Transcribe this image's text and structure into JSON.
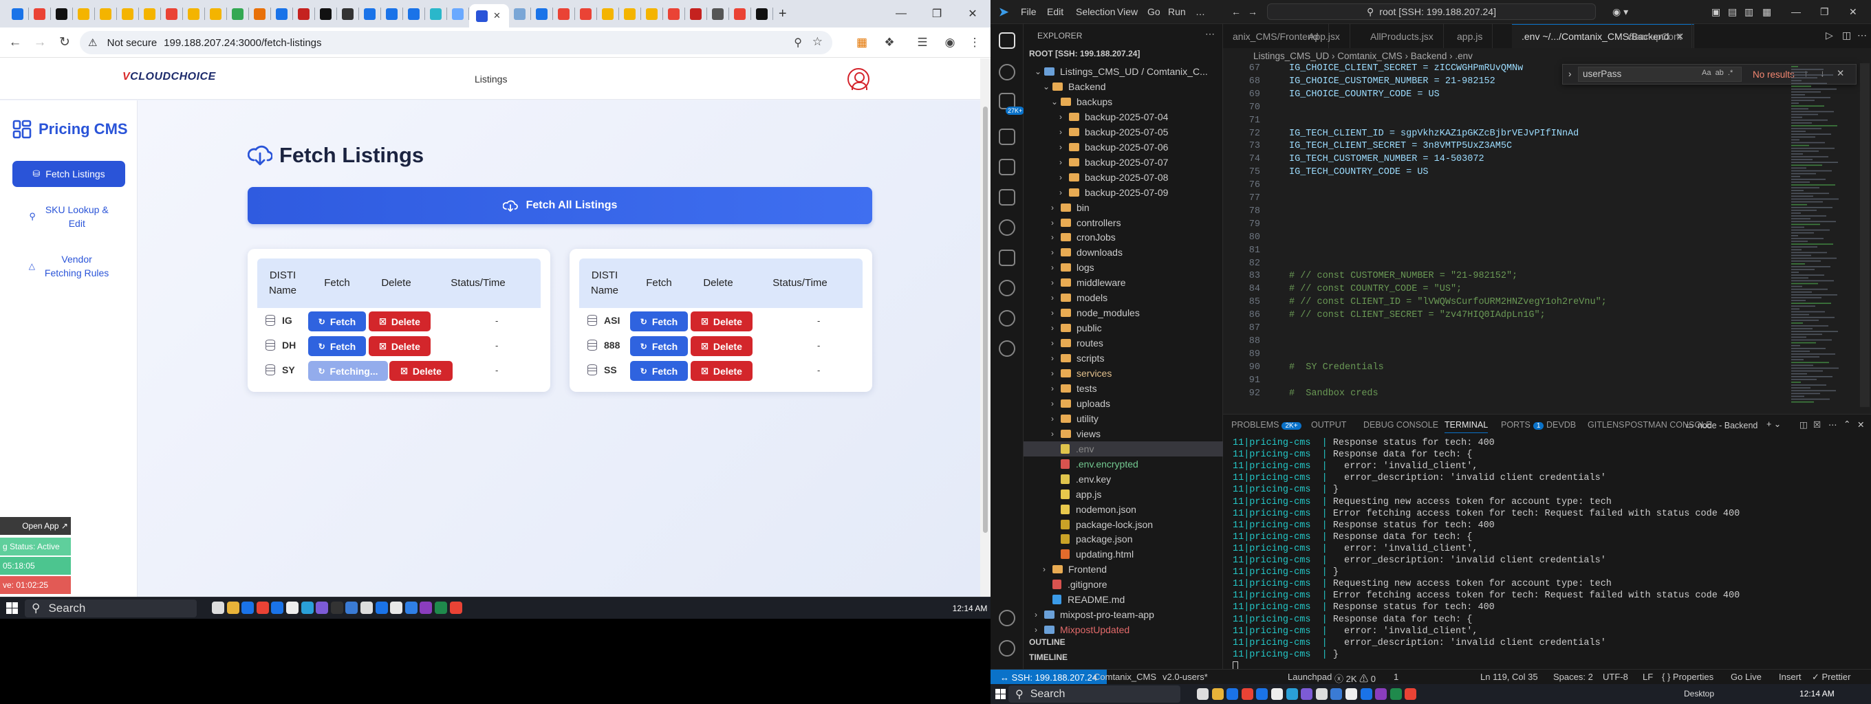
{
  "browser": {
    "tab_title": "",
    "not_secure": "Not secure",
    "url": "199.188.207.24:3000/fetch-listings"
  },
  "app": {
    "logo_main": "CLOUDCHOICE",
    "logo_v": "V",
    "nav_listings": "Listings",
    "brand": "Pricing CMS",
    "sidebar": [
      {
        "label": "Fetch Listings",
        "icon": "download-icon"
      },
      {
        "label": "SKU Lookup &\nEdit",
        "icon": "search-icon"
      },
      {
        "label": "Vendor\nFetching Rules",
        "icon": "warning-icon"
      }
    ],
    "page_title": "Fetch Listings",
    "fetch_all": "Fetch All Listings",
    "headers": {
      "disti": "DISTI\nName",
      "fetch": "Fetch",
      "delete": "Delete",
      "status": "Status/Time"
    },
    "left_table": [
      {
        "name": "IG",
        "fetch": "Fetch",
        "delete": "Delete",
        "status": "-",
        "state": "idle"
      },
      {
        "name": "DH",
        "fetch": "Fetch",
        "delete": "Delete",
        "status": "-",
        "state": "idle"
      },
      {
        "name": "SY",
        "fetch": "Fetching...",
        "delete": "Delete",
        "status": "-",
        "state": "loading"
      }
    ],
    "right_table": [
      {
        "name": "ASI",
        "fetch": "Fetch",
        "delete": "Delete",
        "status": "-",
        "state": "idle"
      },
      {
        "name": "888",
        "fetch": "Fetch",
        "delete": "Delete",
        "status": "-",
        "state": "idle"
      },
      {
        "name": "SS",
        "fetch": "Fetch",
        "delete": "Delete",
        "status": "-",
        "state": "idle"
      }
    ]
  },
  "dock": {
    "open_app": "Open App ↗",
    "status": "g Status: Active",
    "time1": "05:18:05",
    "time2": "ve: 01:02:25"
  },
  "taskbar1": {
    "search": "Search",
    "clock": "12:14 AM"
  },
  "vscode": {
    "menu": [
      "File",
      "Edit",
      "Selection",
      "View",
      "Go",
      "Run",
      "…"
    ],
    "command_center": "root [SSH: 199.188.207.24]",
    "explorer_title": "EXPLORER",
    "root": "ROOT [SSH: 199.188.207.24]",
    "tree": [
      {
        "t": "Listings_CMS_UD / Comtanix_C...",
        "d": 1,
        "k": "open"
      },
      {
        "t": "Backend",
        "d": 2,
        "k": "open"
      },
      {
        "t": "backups",
        "d": 3,
        "k": "open"
      },
      {
        "t": "backup-2025-07-04",
        "d": 4,
        "k": "closed"
      },
      {
        "t": "backup-2025-07-05",
        "d": 4,
        "k": "closed"
      },
      {
        "t": "backup-2025-07-06",
        "d": 4,
        "k": "closed"
      },
      {
        "t": "backup-2025-07-07",
        "d": 4,
        "k": "closed"
      },
      {
        "t": "backup-2025-07-08",
        "d": 4,
        "k": "closed"
      },
      {
        "t": "backup-2025-07-09",
        "d": 4,
        "k": "closed"
      },
      {
        "t": "bin",
        "d": 3,
        "k": "closed"
      },
      {
        "t": "controllers",
        "d": 3,
        "k": "closed"
      },
      {
        "t": "cronJobs",
        "d": 3,
        "k": "closed"
      },
      {
        "t": "downloads",
        "d": 3,
        "k": "closed"
      },
      {
        "t": "logs",
        "d": 3,
        "k": "closed"
      },
      {
        "t": "middleware",
        "d": 3,
        "k": "closed"
      },
      {
        "t": "models",
        "d": 3,
        "k": "closed"
      },
      {
        "t": "node_modules",
        "d": 3,
        "k": "closed"
      },
      {
        "t": "public",
        "d": 3,
        "k": "closed"
      },
      {
        "t": "routes",
        "d": 3,
        "k": "closed"
      },
      {
        "t": "scripts",
        "d": 3,
        "k": "closed"
      },
      {
        "t": "services",
        "d": 3,
        "k": "closed"
      },
      {
        "t": "tests",
        "d": 3,
        "k": "closed"
      },
      {
        "t": "uploads",
        "d": 3,
        "k": "closed"
      },
      {
        "t": "utility",
        "d": 3,
        "k": "closed"
      },
      {
        "t": "views",
        "d": 3,
        "k": "closed"
      },
      {
        "t": ".env",
        "d": 3,
        "k": "file"
      },
      {
        "t": ".env.encrypted",
        "d": 3,
        "k": "file"
      },
      {
        "t": ".env.key",
        "d": 3,
        "k": "file"
      },
      {
        "t": "app.js",
        "d": 3,
        "k": "file"
      },
      {
        "t": "nodemon.json",
        "d": 3,
        "k": "file"
      },
      {
        "t": "package-lock.json",
        "d": 3,
        "k": "file"
      },
      {
        "t": "package.json",
        "d": 3,
        "k": "file"
      },
      {
        "t": "updating.html",
        "d": 3,
        "k": "file"
      },
      {
        "t": "Frontend",
        "d": 2,
        "k": "closed"
      },
      {
        "t": ".gitignore",
        "d": 2,
        "k": "file"
      },
      {
        "t": "README.md",
        "d": 2,
        "k": "file"
      },
      {
        "t": "mixpost-pro-team-app",
        "d": 1,
        "k": "closed"
      },
      {
        "t": "MixpostUpdated",
        "d": 1,
        "k": "closed"
      }
    ],
    "outline": "OUTLINE",
    "timeline": "TIMELINE",
    "tabs": [
      "anix_CMS/Frontend",
      "App.jsx",
      "AllProducts.jsx",
      "app.js",
      ".env  ~/.../Comtanix_CMS/Backend",
      "cleanupCont"
    ],
    "breadcrumb": "Listings_CMS_UD  ›  Comtanix_CMS  ›  Backend  ›  .env",
    "code": [
      {
        "n": "67",
        "t": "IG_CHOICE_CLIENT_SECRET = zICCWGHPmRUvQMNw"
      },
      {
        "n": "68",
        "t": "IG_CHOICE_CUSTOMER_NUMBER = 21-982152"
      },
      {
        "n": "69",
        "t": "IG_CHOICE_COUNTRY_CODE = US"
      },
      {
        "n": "70",
        "t": ""
      },
      {
        "n": "71",
        "t": ""
      },
      {
        "n": "72",
        "t": "IG_TECH_CLIENT_ID = sgpVkhzKAZ1pGKZcBjbrVEJvPIfINnAd"
      },
      {
        "n": "73",
        "t": "IG_TECH_CLIENT_SECRET = 3n8VMTP5UxZ3AM5C"
      },
      {
        "n": "74",
        "t": "IG_TECH_CUSTOMER_NUMBER = 14-503072"
      },
      {
        "n": "75",
        "t": "IG_TECH_COUNTRY_CODE = US"
      },
      {
        "n": "76",
        "t": ""
      },
      {
        "n": "77",
        "t": ""
      },
      {
        "n": "78",
        "t": ""
      },
      {
        "n": "79",
        "t": ""
      },
      {
        "n": "80",
        "t": ""
      },
      {
        "n": "81",
        "t": ""
      },
      {
        "n": "82",
        "t": ""
      },
      {
        "n": "83",
        "t": "# // const CUSTOMER_NUMBER = \"21-982152\";"
      },
      {
        "n": "84",
        "t": "# // const COUNTRY_CODE = \"US\";"
      },
      {
        "n": "85",
        "t": "# // const CLIENT_ID = \"lVWQWsCurfoURM2HNZvegY1oh2reVnu\";"
      },
      {
        "n": "86",
        "t": "# // const CLIENT_SECRET = \"zv47HIQ0IAdpLn1G\";"
      },
      {
        "n": "87",
        "t": ""
      },
      {
        "n": "88",
        "t": ""
      },
      {
        "n": "89",
        "t": ""
      },
      {
        "n": "90",
        "t": "#  SY Credentials"
      },
      {
        "n": "91",
        "t": ""
      },
      {
        "n": "92",
        "t": "#  Sandbox creds"
      }
    ],
    "find_value": "userPass",
    "find_result": "No results",
    "panel_tabs": [
      "PROBLEMS",
      "OUTPUT",
      "DEBUG CONSOLE",
      "TERMINAL",
      "PORTS",
      "DEVDB",
      "GITLENS",
      "POSTMAN CONSOLE"
    ],
    "problems_badge": "2K+",
    "ports_badge": "1",
    "terminal_name": "node - Backend",
    "terminal": [
      "Response status for tech: 400",
      "Response data for tech: {",
      "  error: 'invalid_client',",
      "  error_description: 'invalid client credentials'",
      "}",
      "Requesting new access token for account type: tech",
      "Error fetching access token for tech: Request failed with status code 400",
      "Response status for tech: 400",
      "Response data for tech: {",
      "  error: 'invalid_client',",
      "  error_description: 'invalid client credentials'",
      "}",
      "Requesting new access token for account type: tech",
      "Error fetching access token for tech: Request failed with status code 400",
      "Response status for tech: 400",
      "Response data for tech: {",
      "  error: 'invalid_client',",
      "  error_description: 'invalid client credentials'",
      "}"
    ],
    "terminal_prefix": "11|pricing-cms  | ",
    "status": {
      "remote": "↔ SSH: 199.188.207.24",
      "folder": "Comtanix_CMS",
      "branch": "v2.0-users*",
      "launchpad": "Launchpad",
      "problems": "ⓧ 2K  ⚠ 0",
      "ports": "1",
      "position": "Ln 119, Col 35",
      "spaces": "Spaces: 2",
      "encoding": "UTF-8",
      "eol": "LF",
      "props": "{ } Properties",
      "golive": "Go Live",
      "insert": "Insert",
      "prettier": "✓ Prettier"
    }
  },
  "taskbar2": {
    "search": "Search",
    "desktop": "Desktop",
    "clock": "12:14 AM"
  }
}
